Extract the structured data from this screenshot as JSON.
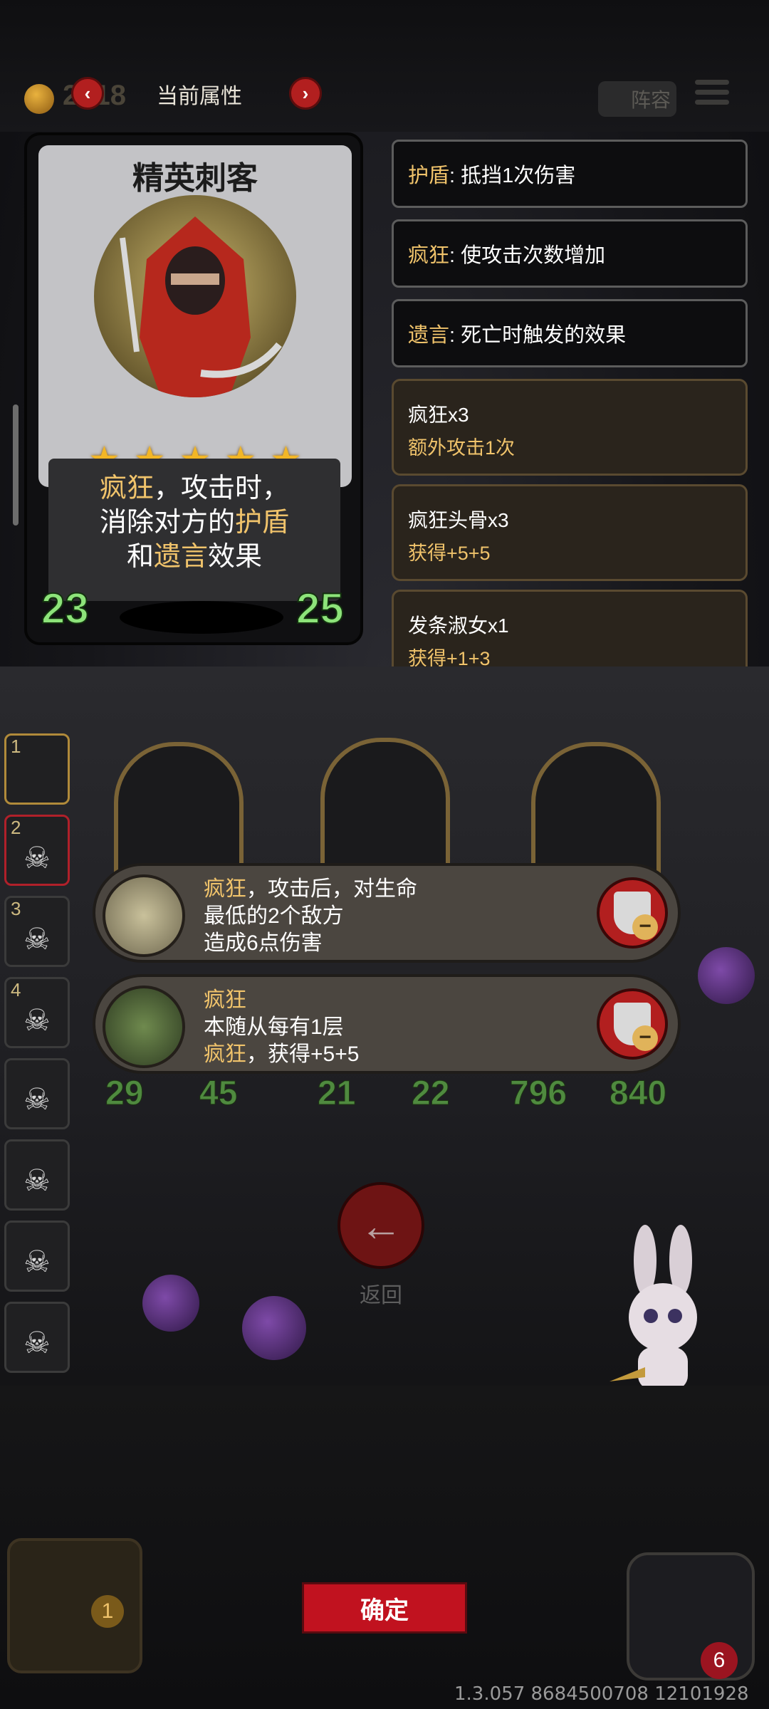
{
  "header": {
    "gold_amount": "2918",
    "title": "当前属性",
    "lineup_label": "阵容"
  },
  "card": {
    "name": "精英刺客",
    "stars": 5,
    "desc_line1_kw": "疯狂",
    "desc_line1_rest": "，攻击时，",
    "desc_line2_pre": "消除对方的",
    "desc_line2_kw": "护盾",
    "desc_line3_pre": "和",
    "desc_line3_kw": "遗言",
    "desc_line3_post": "效果",
    "attack": "23",
    "health": "25"
  },
  "keywords": [
    {
      "name": "护盾",
      "desc": ": 抵挡1次伤害"
    },
    {
      "name": "疯狂",
      "desc": ": 使攻击次数增加"
    },
    {
      "name": "遗言",
      "desc": ": 死亡时触发的效果"
    }
  ],
  "items": [
    {
      "title": "疯狂x3",
      "effect": "额外攻击1次"
    },
    {
      "title": "疯狂头骨x3",
      "effect": "获得+5+5"
    },
    {
      "title": "发条淑女x1",
      "effect": "获得+1+3"
    }
  ],
  "team_slots": [
    "1",
    "2",
    "3",
    "4"
  ],
  "skills": [
    {
      "line1_kw": "疯狂",
      "line1_rest": "，攻击后，对生命",
      "line2": "最低的2个敌方",
      "line3": "造成6点伤害"
    },
    {
      "line1_kw": "疯狂",
      "line2": "本随从每有1层",
      "line3_kw": "疯狂",
      "line3_rest": "，获得+5+5"
    }
  ],
  "board_stats": [
    {
      "atk": "29",
      "hp": "45"
    },
    {
      "atk": "21",
      "hp": "22"
    },
    {
      "atk": "796",
      "hp": "840"
    }
  ],
  "back_label": "返回",
  "confirm_label": "确定",
  "chest_count": "1",
  "hero_badge": "6",
  "version": "1.3.057 8684500708 12101928",
  "colors": {
    "keyword": "#f0c36b",
    "stat_green": "#8de37a",
    "button_red": "#c1121f"
  }
}
